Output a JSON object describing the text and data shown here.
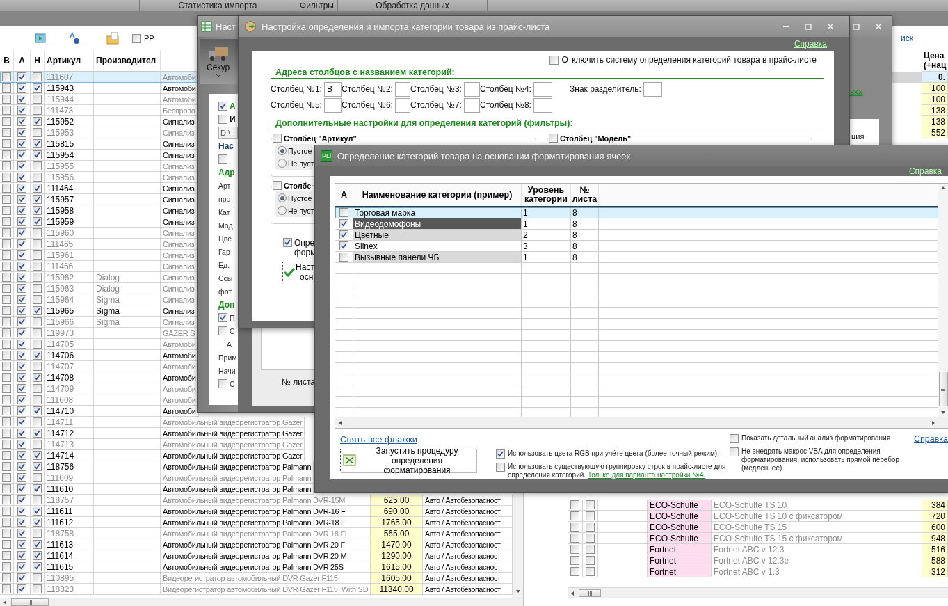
{
  "app_tabs": [
    {
      "label": "Статистика импорта"
    },
    {
      "label": "Фильтры"
    },
    {
      "label": "Обработка данных"
    }
  ],
  "toolbar": {
    "pp": {
      "label": "PP",
      "checked": false
    }
  },
  "products": {
    "columns": [
      "В",
      "А",
      "Н",
      "Артикул",
      "Производител"
    ],
    "rows": [
      {
        "b": false,
        "a": true,
        "n": false,
        "article": "111607",
        "name": "Автомоби",
        "selected": true
      },
      {
        "b": false,
        "a": true,
        "n": true,
        "article": "115943",
        "name": "Автомоби",
        "selected": false
      },
      {
        "b": false,
        "a": true,
        "n": false,
        "article": "115944",
        "name": "Автомоби",
        "selected": false
      },
      {
        "b": false,
        "a": true,
        "n": false,
        "article": "111473",
        "name": "Беспрово",
        "selected": false
      },
      {
        "b": false,
        "a": true,
        "n": true,
        "article": "115952",
        "name": "Сигнализ",
        "selected": false
      },
      {
        "b": false,
        "a": true,
        "n": false,
        "article": "115953",
        "name": "Сигнализ",
        "selected": false
      },
      {
        "b": false,
        "a": true,
        "n": true,
        "article": "115815",
        "name": "Сигнализ",
        "selected": false
      },
      {
        "b": false,
        "a": true,
        "n": true,
        "article": "115954",
        "name": "Сигнализ",
        "selected": false
      },
      {
        "b": false,
        "a": true,
        "n": false,
        "article": "115955",
        "name": "Сигнализ",
        "selected": false
      },
      {
        "b": false,
        "a": true,
        "n": false,
        "article": "115956",
        "name": "Сигнализ",
        "selected": false
      },
      {
        "b": false,
        "a": true,
        "n": true,
        "article": "111464",
        "name": "Сигнализ",
        "selected": false
      },
      {
        "b": false,
        "a": true,
        "n": true,
        "article": "115957",
        "name": "Сигнализ",
        "selected": false
      },
      {
        "b": false,
        "a": true,
        "n": true,
        "article": "115958",
        "name": "Сигнализ",
        "selected": false
      },
      {
        "b": false,
        "a": true,
        "n": true,
        "article": "115959",
        "name": "Сигнализ",
        "selected": false
      },
      {
        "b": false,
        "a": true,
        "n": false,
        "article": "115960",
        "name": "Сигнализ",
        "selected": false
      },
      {
        "b": false,
        "a": true,
        "n": false,
        "article": "111465",
        "name": "Сигнализ",
        "selected": false
      },
      {
        "b": false,
        "a": true,
        "n": false,
        "article": "115961",
        "name": "Сигнализ",
        "selected": false
      },
      {
        "b": false,
        "a": true,
        "n": false,
        "article": "111466",
        "name": "Сигнализ",
        "selected": false
      },
      {
        "b": false,
        "a": true,
        "n": false,
        "article": "115962",
        "maker": "Dialog",
        "name": "Сигнализ",
        "selected": false
      },
      {
        "b": false,
        "a": true,
        "n": false,
        "article": "115963",
        "maker": "Dialog",
        "name": "Сигнализ",
        "selected": false
      },
      {
        "b": false,
        "a": true,
        "n": false,
        "article": "115964",
        "maker": "Sigma",
        "name": "Сигнализ",
        "selected": false
      },
      {
        "b": false,
        "a": true,
        "n": true,
        "article": "115965",
        "maker": "Sigma",
        "name": "Сигнализ",
        "selected": false
      },
      {
        "b": false,
        "a": true,
        "n": false,
        "article": "115966",
        "maker": "Sigma",
        "name": "Сигнализ",
        "selected": false
      },
      {
        "b": false,
        "a": true,
        "n": false,
        "article": "119973",
        "name": "GAZER S",
        "selected": false
      },
      {
        "b": false,
        "a": true,
        "n": false,
        "article": "114705",
        "name": "Автомоби",
        "selected": false
      },
      {
        "b": false,
        "a": true,
        "n": true,
        "article": "114706",
        "name": "Автомоби",
        "selected": false
      },
      {
        "b": false,
        "a": true,
        "n": false,
        "article": "114707",
        "name": "Автомоби",
        "selected": false
      },
      {
        "b": false,
        "a": true,
        "n": true,
        "article": "114708",
        "name": "Автомоби",
        "selected": false
      },
      {
        "b": false,
        "a": true,
        "n": false,
        "article": "114709",
        "name": "Автомоби",
        "selected": false
      },
      {
        "b": false,
        "a": true,
        "n": false,
        "article": "111608",
        "name": "Автомоби",
        "selected": false
      },
      {
        "b": false,
        "a": true,
        "n": true,
        "article": "114710",
        "name": "Автомоби",
        "selected": false
      },
      {
        "b": false,
        "a": true,
        "n": false,
        "article": "114711",
        "name": "Автомобильный видеорегистратор Gazer",
        "selected": false
      },
      {
        "b": false,
        "a": true,
        "n": true,
        "article": "114712",
        "name": "Автомобильный видеорегистратор Gazer",
        "selected": false
      },
      {
        "b": false,
        "a": true,
        "n": false,
        "article": "114713",
        "name": "Автомобильный видеорегистратор Gazer",
        "selected": false
      },
      {
        "b": false,
        "a": true,
        "n": true,
        "article": "114714",
        "name": "Автомобильный видеорегистратор Gazer",
        "selected": false
      },
      {
        "b": false,
        "a": true,
        "n": true,
        "article": "118756",
        "name": "Автомобильный видеорегистратор Palmann",
        "selected": false
      },
      {
        "b": false,
        "a": true,
        "n": false,
        "article": "111609",
        "name": "Автомобильный видеорегистратор Palmann",
        "selected": false
      },
      {
        "b": false,
        "a": true,
        "n": true,
        "article": "111610",
        "name": "Автомобильный видеорегистратор Palmann",
        "selected": false
      },
      {
        "b": false,
        "a": true,
        "n": false,
        "article": "118757",
        "name": "Автомобильный видеорегистратор Palmann DVR-15M",
        "price": "625.00",
        "category": "Авто / Автобезопасност",
        "selected": false
      },
      {
        "b": false,
        "a": true,
        "n": true,
        "article": "111611",
        "name": "Автомобильный видеорегистратор Palmann DVR-16 F",
        "price": "690.00",
        "category": "Авто / Автобезопасност",
        "selected": false
      },
      {
        "b": false,
        "a": true,
        "n": true,
        "article": "111612",
        "name": "Автомобильный видеорегистратор Palmann DVR-18 F",
        "price": "1765.00",
        "category": "Авто / Автобезопасност",
        "selected": false
      },
      {
        "b": false,
        "a": true,
        "n": false,
        "article": "118758",
        "name": "Автомобильный видеорегистратор Palmann DVR 18 FL",
        "price": "565.00",
        "category": "Авто / Автобезопасност",
        "selected": false
      },
      {
        "b": false,
        "a": true,
        "n": true,
        "article": "111613",
        "name": "Автомобильный видеорегистратор Palmann DVR 20 F",
        "price": "1470.00",
        "category": "Авто / Автобезопасност",
        "selected": false
      },
      {
        "b": false,
        "a": true,
        "n": true,
        "article": "111614",
        "name": "Автомобильный видеорегистратор Palmann DVR 20 M",
        "price": "1290.00",
        "category": "Авто / Автобезопасност",
        "selected": false
      },
      {
        "b": false,
        "a": true,
        "n": true,
        "article": "111615",
        "name": "Автомобильный видеорегистратор Palmann DVR 25S",
        "price": "1615.00",
        "category": "Авто / Автобезопасност",
        "selected": false
      },
      {
        "b": false,
        "a": true,
        "n": false,
        "article": "110895",
        "name": "Видеорегистратор автомобильный DVR Gazer F115",
        "price": "1605.00",
        "category": "Авто / Автобезопасност",
        "selected": false
      },
      {
        "b": false,
        "a": true,
        "n": false,
        "article": "118823",
        "name": "Видеорегистратор автомобильный DVR Gazer F115  With SD",
        "price": "11340.00",
        "category": "Авто / Автобезопасност",
        "selected": false
      }
    ]
  },
  "catalog": {
    "link": "иск",
    "price_header": "Цена\n(+нац",
    "top_rows": [
      {
        "price": "0.",
        "selected": true
      },
      {
        "price": "100",
        "selected": false
      },
      {
        "price": "100",
        "selected": false
      },
      {
        "price": "138",
        "selected": false
      },
      {
        "price": "138",
        "selected": false
      },
      {
        "price": "552",
        "selected": false
      }
    ],
    "rows": [
      {
        "c1": false,
        "c2": false,
        "brand": "ECO-Schulte",
        "model": "ECO-Schulte TS 10",
        "price": "384"
      },
      {
        "c1": false,
        "c2": false,
        "brand": "ECO-Schulte",
        "model": "ECO-Schulte TS 10 с фиксатором",
        "price": "720"
      },
      {
        "c1": false,
        "c2": false,
        "brand": "ECO-Schulte",
        "model": "ECO-Schulte TS 15",
        "price": "600"
      },
      {
        "c1": false,
        "c2": false,
        "brand": "ECO-Schulte",
        "model": "ECO-Schulte TS 15 с фиксатором",
        "price": "948"
      },
      {
        "c1": false,
        "c2": false,
        "brand": "Fortnet",
        "model": "Fortnet ABC v 12.3",
        "price": "516"
      },
      {
        "c1": false,
        "c2": false,
        "brand": "Fortnet",
        "model": "Fortnet ABC v 12.3e",
        "price": "588"
      },
      {
        "c1": false,
        "c2": false,
        "brand": "Fortnet",
        "model": "Fortnet ABC v 1.3",
        "price": "312"
      }
    ]
  },
  "import_window": {
    "title": "Наст",
    "tool_button": "Секур",
    "items": [
      {
        "kind": "check",
        "label": "А",
        "checked": true,
        "color": "#1c8c1c"
      },
      {
        "kind": "check",
        "label": "И",
        "checked": false,
        "color": "#111111"
      },
      {
        "kind": "field",
        "value": "D:\\"
      },
      {
        "kind": "heading",
        "label": "Нас",
        "color": "#1d3f6e"
      },
      {
        "kind": "check",
        "checked": false
      },
      {
        "kind": "heading",
        "label": "Адр",
        "color": "#1c8c1c"
      },
      {
        "kind": "label",
        "label": "Арт"
      },
      {
        "kind": "label",
        "label": "про"
      },
      {
        "kind": "label",
        "label": "Кат"
      },
      {
        "kind": "label",
        "label": "Мод"
      },
      {
        "kind": "label",
        "label": "Цве"
      },
      {
        "kind": "label",
        "label": "Гар"
      },
      {
        "kind": "label",
        "label": "Ед."
      },
      {
        "kind": "label",
        "label": "Ссы"
      },
      {
        "kind": "label",
        "label": "фот"
      },
      {
        "kind": "heading",
        "label": "Доп",
        "color": "#1c8c1c"
      },
      {
        "kind": "check",
        "label": "П",
        "checked": true
      },
      {
        "kind": "check",
        "label": "С",
        "checked": false
      },
      {
        "kind": "label",
        "label": "А",
        "indent": true
      },
      {
        "kind": "label",
        "label": "Прим"
      },
      {
        "kind": "label",
        "label": "Начи"
      },
      {
        "kind": "check",
        "label": "С",
        "checked": false
      }
    ],
    "sheet_label": "№ листа",
    "side_link": "вка",
    "side_text": "ция"
  },
  "category_window": {
    "title": "Настройка определения и импорта категорий товара из прайс-листа",
    "help": "Справка",
    "disable": {
      "label": "Отключить систему определения категорий товара в прайс-листе",
      "checked": false
    },
    "address_heading": "Адреса столбцов с названием категорий:",
    "fields": [
      {
        "label": "Столбец №1:",
        "value": "B"
      },
      {
        "label": "Столбец №2:"
      },
      {
        "label": "Столбец №3:"
      },
      {
        "label": "Столбец №4:"
      },
      {
        "label": "Столбец №5:"
      },
      {
        "label": "Столбец №6:"
      },
      {
        "label": "Столбец №7:"
      },
      {
        "label": "Столбец №8:"
      }
    ],
    "separator": {
      "label": "Знак разделитель:"
    },
    "filters_heading": "Дополнительные настройки для определения категорий (фильтры):",
    "groups": [
      {
        "label": "Столбец \"Артикул\"",
        "checked": false,
        "radios": [
          {
            "label": "Пустое",
            "selected": true
          },
          {
            "label": "Не пуст",
            "selected": false
          }
        ]
      },
      {
        "label": "Столбец \"Модель\"",
        "checked": false
      },
      {
        "label": "Столбе",
        "checked": false,
        "radios": [
          {
            "label": "Пустое",
            "selected": true
          },
          {
            "label": "Не пуст",
            "selected": false
          }
        ]
      }
    ],
    "format_check": {
      "lines": [
        "Опре",
        "форм"
      ],
      "checked": true
    },
    "setup_button": {
      "lines": [
        "Наст",
        "осн"
      ]
    }
  },
  "format_window": {
    "logo": "PLi",
    "title": "Определение категорий товара на основании форматирования ячеек",
    "help": "Справка",
    "columns": [
      "А",
      "Наименование категории (пример)",
      "Уровень\nкатегории",
      "№\nлиста"
    ],
    "rows": [
      {
        "checked": false,
        "name": "Торговая марка",
        "category_level": "1",
        "sheet": "8",
        "selected": true
      },
      {
        "checked": true,
        "name": "Видеодомофоны",
        "category_level": "1",
        "sheet": "8",
        "selected": false,
        "color": "#575757"
      },
      {
        "checked": true,
        "name": "Цветные",
        "category_level": "2",
        "sheet": "8",
        "selected": false,
        "color": "#d9d9d9"
      },
      {
        "checked": true,
        "name": "Slinex",
        "category_level": "3",
        "sheet": "8",
        "selected": false,
        "color": "#ffffff"
      },
      {
        "checked": false,
        "name": "Вызывные панели ЧБ",
        "category_level": "1",
        "sheet": "8",
        "selected": false,
        "color": "#d9d9d9"
      }
    ],
    "uncheck_all": "Снять все флажки",
    "run_button": "Запустить процедуру\nопределения форматирования",
    "options": [
      {
        "label": "Использовать цвета RGB при учёте цвета (более точный режим).",
        "checked": true
      },
      {
        "label": "Использовать существующую группировку строк в прайс-листе для определения категорий.",
        "checked": false,
        "link": "Только для варианта настройки №4."
      },
      {
        "label": "Показать детальный анализ форматирования",
        "checked": false
      },
      {
        "label": "Не внедрять макрос VBA для определения форматирования, использовать прямой перебор (медленнее)",
        "checked": false
      }
    ],
    "help_bottom": "Справка"
  }
}
